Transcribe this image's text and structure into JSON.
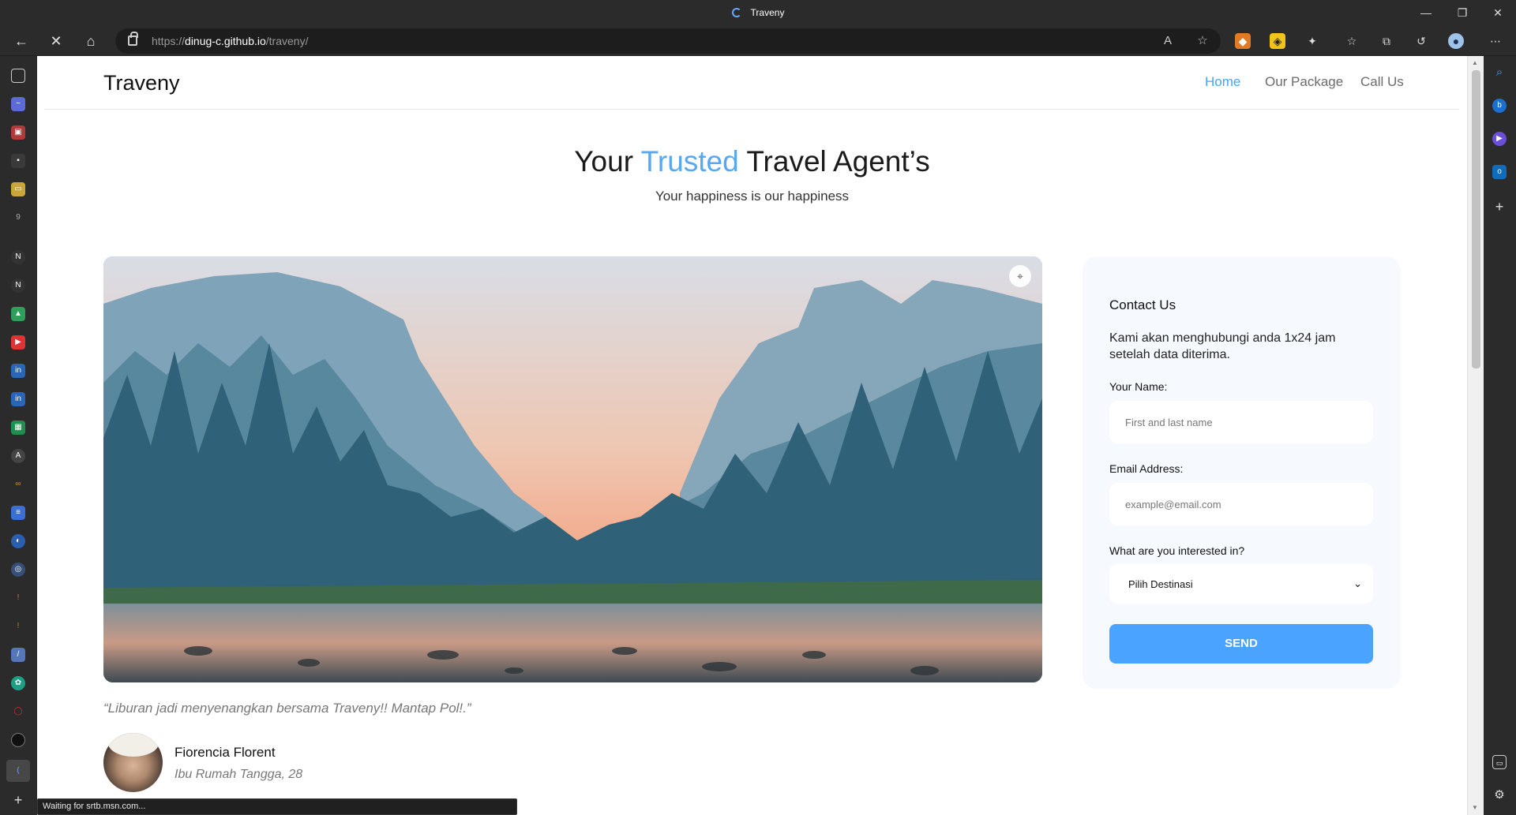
{
  "browser": {
    "tab_title": "Traveny",
    "url_prefix": "https://",
    "url_domain": "dinug-c.github.io",
    "url_path": "/traveny/",
    "status_text": "Waiting for srtb.msn.com..."
  },
  "site": {
    "brand": "Traveny",
    "nav": [
      "Home",
      "Our Package",
      "Call Us"
    ],
    "active_nav": "Home"
  },
  "hero": {
    "title_before": "Your ",
    "title_highlight": "Trusted",
    "title_after": " Travel Agent’s",
    "subtitle": "Your happiness is our happiness"
  },
  "testimonial": {
    "quote": "“Liburan jadi menyenangkan bersama Traveny!! Mantap Pol!.”",
    "name": "Fiorencia Florent",
    "role": "Ibu Rumah Tangga, 28"
  },
  "contact": {
    "heading": "Contact Us",
    "description": "Kami akan menghubungi anda 1x24 jam setelah data diterima.",
    "name_label": "Your Name:",
    "name_placeholder": "First and last name",
    "email_label": "Email Address:",
    "email_placeholder": "example@email.com",
    "interest_label": "What are you interested in?",
    "interest_selected": "Pilih Destinasi",
    "send_label": "SEND"
  },
  "colors": {
    "accent": "#4aa3ff",
    "chrome": "#2b2b2b",
    "card": "#f6f9fd"
  },
  "icons": {
    "back": "←",
    "stop": "✕",
    "home": "⌂",
    "more": "⋯",
    "plus": "+",
    "settings": "⚙"
  }
}
